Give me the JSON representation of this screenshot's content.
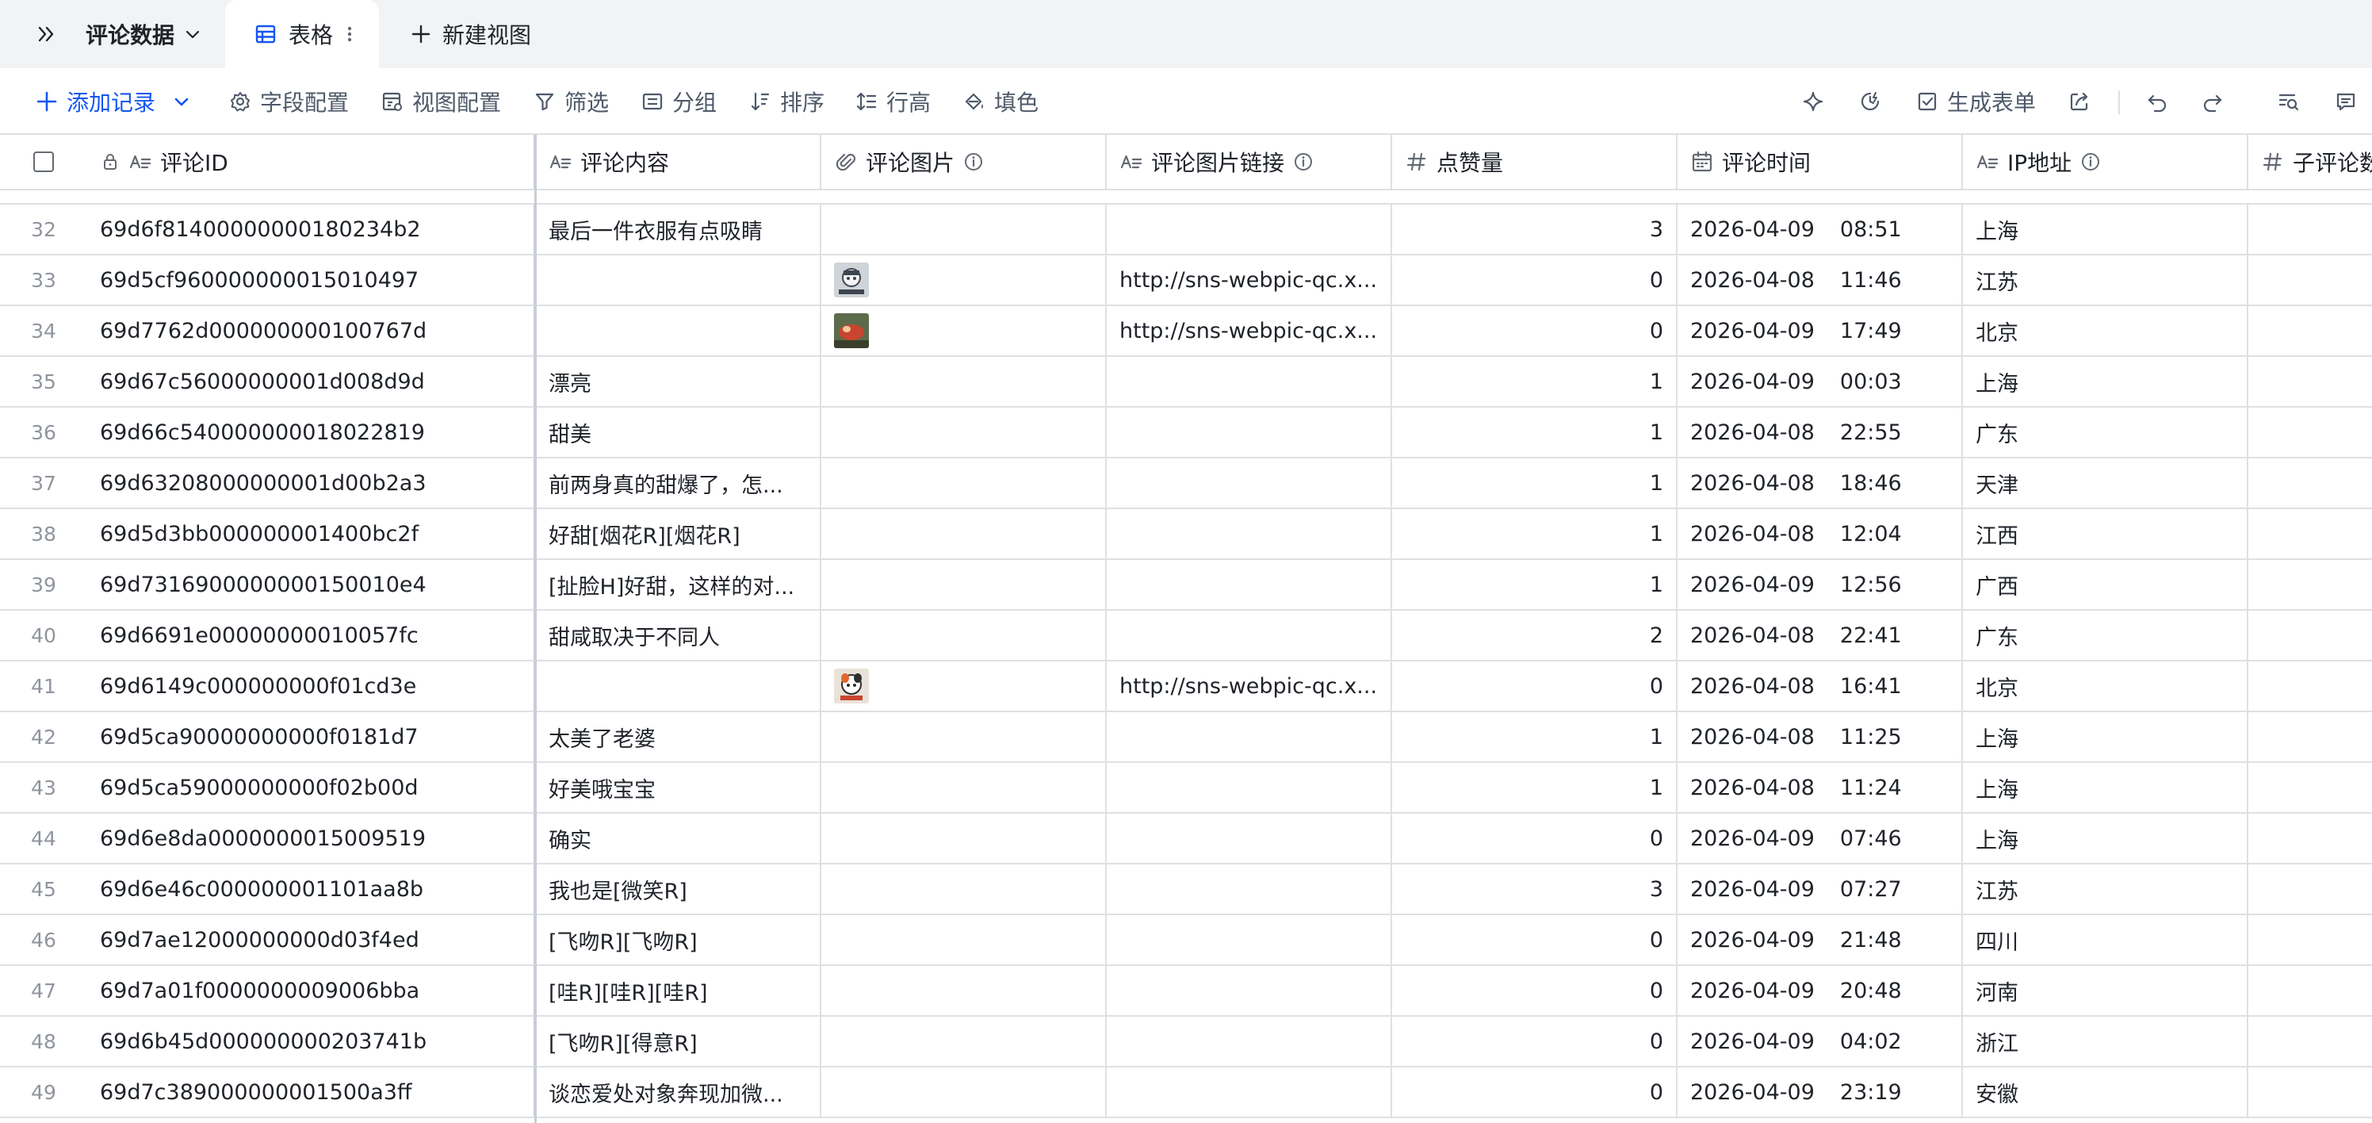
{
  "tabbar": {
    "dataset_name": "评论数据",
    "active_view": "表格",
    "new_view_label": "新建视图"
  },
  "toolbar": {
    "add_record": "添加记录",
    "field_config": "字段配置",
    "view_config": "视图配置",
    "filter": "筛选",
    "group": "分组",
    "sort": "排序",
    "row_height": "行高",
    "fill": "填色",
    "generate_form": "生成表单"
  },
  "columns": {
    "comment_id": "评论ID",
    "content": "评论内容",
    "image": "评论图片",
    "image_link": "评论图片链接",
    "likes": "点赞量",
    "time": "评论时间",
    "ip": "IP地址",
    "sub_comments": "子评论数"
  },
  "rows": [
    {
      "idx": "32",
      "id": "69d6f81400000000180234b2",
      "content": "最后一件衣服有点吸睛",
      "image": "",
      "link": "",
      "likes": "3",
      "date": "2026-04-09",
      "clock": "08:51",
      "ip": "上海"
    },
    {
      "idx": "33",
      "id": "69d5cf960000000015010497",
      "content": "",
      "image": "thumb-a",
      "link": "http://sns-webpic-qc.x...",
      "likes": "0",
      "date": "2026-04-08",
      "clock": "11:46",
      "ip": "江苏"
    },
    {
      "idx": "34",
      "id": "69d7762d000000000100767d",
      "content": "",
      "image": "thumb-b",
      "link": "http://sns-webpic-qc.x...",
      "likes": "0",
      "date": "2026-04-09",
      "clock": "17:49",
      "ip": "北京"
    },
    {
      "idx": "35",
      "id": "69d67c56000000001d008d9d",
      "content": "漂亮",
      "image": "",
      "link": "",
      "likes": "1",
      "date": "2026-04-09",
      "clock": "00:03",
      "ip": "上海"
    },
    {
      "idx": "36",
      "id": "69d66c540000000018022819",
      "content": "甜美",
      "image": "",
      "link": "",
      "likes": "1",
      "date": "2026-04-08",
      "clock": "22:55",
      "ip": "广东"
    },
    {
      "idx": "37",
      "id": "69d63208000000001d00b2a3",
      "content": "前两身真的甜爆了，怎...",
      "image": "",
      "link": "",
      "likes": "1",
      "date": "2026-04-08",
      "clock": "18:46",
      "ip": "天津"
    },
    {
      "idx": "38",
      "id": "69d5d3bb000000001400bc2f",
      "content": "好甜[烟花R][烟花R]",
      "image": "",
      "link": "",
      "likes": "1",
      "date": "2026-04-08",
      "clock": "12:04",
      "ip": "江西"
    },
    {
      "idx": "39",
      "id": "69d7316900000000150010e4",
      "content": "[扯脸H]好甜，这样的对...",
      "image": "",
      "link": "",
      "likes": "1",
      "date": "2026-04-09",
      "clock": "12:56",
      "ip": "广西"
    },
    {
      "idx": "40",
      "id": "69d6691e00000000010057fc",
      "content": "甜咸取决于不同人",
      "image": "",
      "link": "",
      "likes": "2",
      "date": "2026-04-08",
      "clock": "22:41",
      "ip": "广东"
    },
    {
      "idx": "41",
      "id": "69d6149c000000000f01cd3e",
      "content": "",
      "image": "thumb-c",
      "link": "http://sns-webpic-qc.x...",
      "likes": "0",
      "date": "2026-04-08",
      "clock": "16:41",
      "ip": "北京"
    },
    {
      "idx": "42",
      "id": "69d5ca90000000000f0181d7",
      "content": "太美了老婆",
      "image": "",
      "link": "",
      "likes": "1",
      "date": "2026-04-08",
      "clock": "11:25",
      "ip": "上海"
    },
    {
      "idx": "43",
      "id": "69d5ca59000000000f02b00d",
      "content": "好美哦宝宝",
      "image": "",
      "link": "",
      "likes": "1",
      "date": "2026-04-08",
      "clock": "11:24",
      "ip": "上海"
    },
    {
      "idx": "44",
      "id": "69d6e8da0000000015009519",
      "content": "确实",
      "image": "",
      "link": "",
      "likes": "0",
      "date": "2026-04-09",
      "clock": "07:46",
      "ip": "上海"
    },
    {
      "idx": "45",
      "id": "69d6e46c000000001101aa8b",
      "content": "我也是[微笑R]",
      "image": "",
      "link": "",
      "likes": "3",
      "date": "2026-04-09",
      "clock": "07:27",
      "ip": "江苏"
    },
    {
      "idx": "46",
      "id": "69d7ae12000000000d03f4ed",
      "content": "[飞吻R][飞吻R]",
      "image": "",
      "link": "",
      "likes": "0",
      "date": "2026-04-09",
      "clock": "21:48",
      "ip": "四川"
    },
    {
      "idx": "47",
      "id": "69d7a01f0000000009006bba",
      "content": "[哇R][哇R][哇R]",
      "image": "",
      "link": "",
      "likes": "0",
      "date": "2026-04-09",
      "clock": "20:48",
      "ip": "河南"
    },
    {
      "idx": "48",
      "id": "69d6b45d000000000203741b",
      "content": "[飞吻R][得意R]",
      "image": "",
      "link": "",
      "likes": "0",
      "date": "2026-04-09",
      "clock": "04:02",
      "ip": "浙江"
    },
    {
      "idx": "49",
      "id": "69d7c389000000001500a3ff",
      "content": "谈恋爱处对象奔现加微...",
      "image": "",
      "link": "",
      "likes": "0",
      "date": "2026-04-09",
      "clock": "23:19",
      "ip": "安徽"
    }
  ],
  "colors": {
    "accent": "#1456f0",
    "text": "#1f2329",
    "muted": "#8f959e",
    "border": "#dee0e3",
    "tabbar_bg": "#f2f3f5"
  }
}
